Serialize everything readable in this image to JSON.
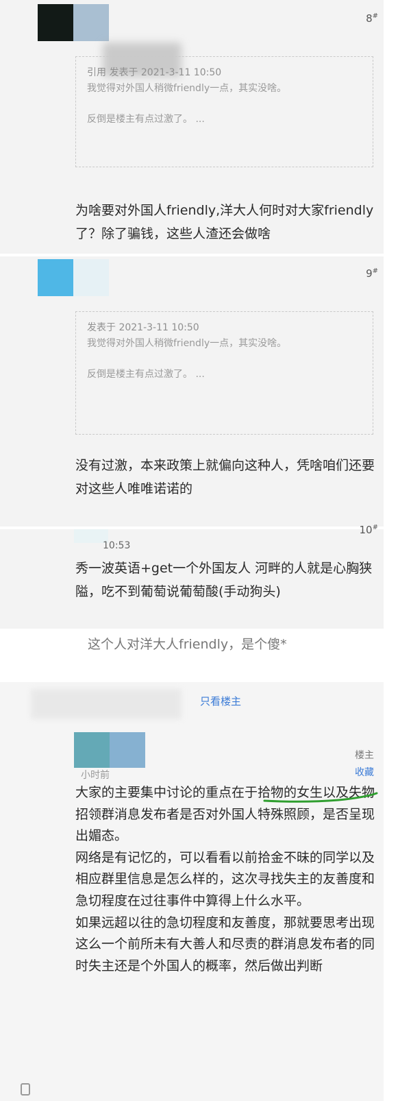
{
  "posts": [
    {
      "floor": "8",
      "quote": {
        "head": "引用 发表于 2021-3-11 10:50",
        "body": "我觉得对外国人稍微friendly一点，其实没啥。",
        "tail": "反倒是楼主有点过激了。 ..."
      },
      "reply": "为啥要对外国人friendly,洋大人何时对大家friendly了？除了骗钱，这些人渣还会做啥"
    },
    {
      "floor": "9",
      "quote": {
        "head": "发表于 2021-3-11 10:50",
        "body": "我觉得对外国人稍微friendly一点，其实没啥。",
        "tail": "反倒是楼主有点过激了。 ..."
      },
      "reply": "没有过激，本来政策上就偏向这种人，凭啥咱们还要对这些人唯唯诺诺的"
    },
    {
      "floor": "10",
      "time": "10:53",
      "reply": "秀一波英语+get一个外国友人 河畔的人就是心胸狭隘，吃不到葡萄说葡萄酸(手动狗头)"
    }
  ],
  "caption": "这个人对洋大人friendly，是个傻*",
  "op_post": {
    "only_host": "只看楼主",
    "host_badge": "楼主",
    "favorite": "收藏",
    "time": "小时前",
    "paragraphs": [
      "大家的主要集中讨论的重点在于拾物的女生以及失物招领群消息发布者是否对外国人特殊照顾，是否呈现出媚态。",
      "网络是有记忆的，可以看看以前拾金不昧的同学以及相应群里信息是怎么样的，这次寻找失主的友善度和急切程度在过往事件中算得上什么水平。",
      "如果远超以往的急切程度和友善度，那就要思考出现这么一个前所未有大善人和尽责的群消息发布者的同时失主还是个外国人的概率，然后做出判断"
    ]
  },
  "colors": {
    "post_bg": "#f3f3f3",
    "link_blue": "#3b7bd6",
    "highlight_green": "#2f9e2f"
  }
}
